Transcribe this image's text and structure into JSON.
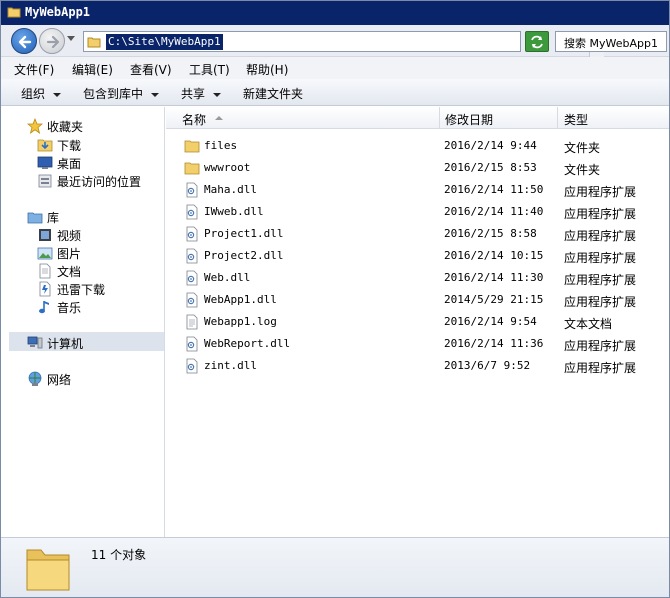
{
  "window": {
    "title": "MyWebApp1"
  },
  "address": {
    "path": "C:\\Site\\MyWebApp1",
    "search_placeholder": "搜索 MyWebApp1"
  },
  "menu": [
    "文件(F)",
    "编辑(E)",
    "查看(V)",
    "工具(T)",
    "帮助(H)"
  ],
  "toolbar": {
    "organize": "组织",
    "include_library": "包含到库中",
    "share": "共享",
    "new_folder": "新建文件夹"
  },
  "nav": {
    "favorites": {
      "label": "收藏夹",
      "icon": "star-icon"
    },
    "favorites_items": [
      {
        "label": "下载",
        "icon": "download-folder-icon"
      },
      {
        "label": "桌面",
        "icon": "desktop-icon"
      },
      {
        "label": "最近访问的位置",
        "icon": "recent-places-icon"
      }
    ],
    "library": {
      "label": "库",
      "icon": "library-icon"
    },
    "library_items": [
      {
        "label": "视频",
        "icon": "video-icon"
      },
      {
        "label": "图片",
        "icon": "picture-icon"
      },
      {
        "label": "文档",
        "icon": "document-icon"
      },
      {
        "label": "迅雷下载",
        "icon": "thunder-download-icon"
      },
      {
        "label": "音乐",
        "icon": "music-icon"
      }
    ],
    "computer": {
      "label": "计算机",
      "icon": "computer-icon"
    },
    "network": {
      "label": "网络",
      "icon": "network-icon"
    }
  },
  "columns": {
    "name": "名称",
    "date": "修改日期",
    "type": "类型"
  },
  "files": [
    {
      "name": "files",
      "date": "2016/2/14 9:44",
      "type": "文件夹",
      "icon": "folder-icon"
    },
    {
      "name": "wwwroot",
      "date": "2016/2/15 8:53",
      "type": "文件夹",
      "icon": "folder-icon"
    },
    {
      "name": "Maha.dll",
      "date": "2016/2/14 11:50",
      "type": "应用程序扩展",
      "icon": "dll-icon"
    },
    {
      "name": "IWweb.dll",
      "date": "2016/2/14 11:40",
      "type": "应用程序扩展",
      "icon": "dll-icon"
    },
    {
      "name": "Project1.dll",
      "date": "2016/2/15 8:58",
      "type": "应用程序扩展",
      "icon": "dll-icon"
    },
    {
      "name": "Project2.dll",
      "date": "2016/2/14 10:15",
      "type": "应用程序扩展",
      "icon": "dll-icon"
    },
    {
      "name": "Web.dll",
      "date": "2016/2/14 11:30",
      "type": "应用程序扩展",
      "icon": "dll-icon"
    },
    {
      "name": "WebApp1.dll",
      "date": "2014/5/29 21:15",
      "type": "应用程序扩展",
      "icon": "dll-icon"
    },
    {
      "name": "Webapp1.log",
      "date": "2016/2/14 9:54",
      "type": "文本文档",
      "icon": "text-file-icon"
    },
    {
      "name": "WebReport.dll",
      "date": "2016/2/14 11:36",
      "type": "应用程序扩展",
      "icon": "dll-icon"
    },
    {
      "name": "zint.dll",
      "date": "2013/6/7 9:52",
      "type": "应用程序扩展",
      "icon": "dll-icon"
    }
  ],
  "status": {
    "count": "11 个对象"
  },
  "colors": {
    "titlebar": "#0a246a",
    "selection": "#0a246a",
    "folder": "#e8c15a"
  }
}
